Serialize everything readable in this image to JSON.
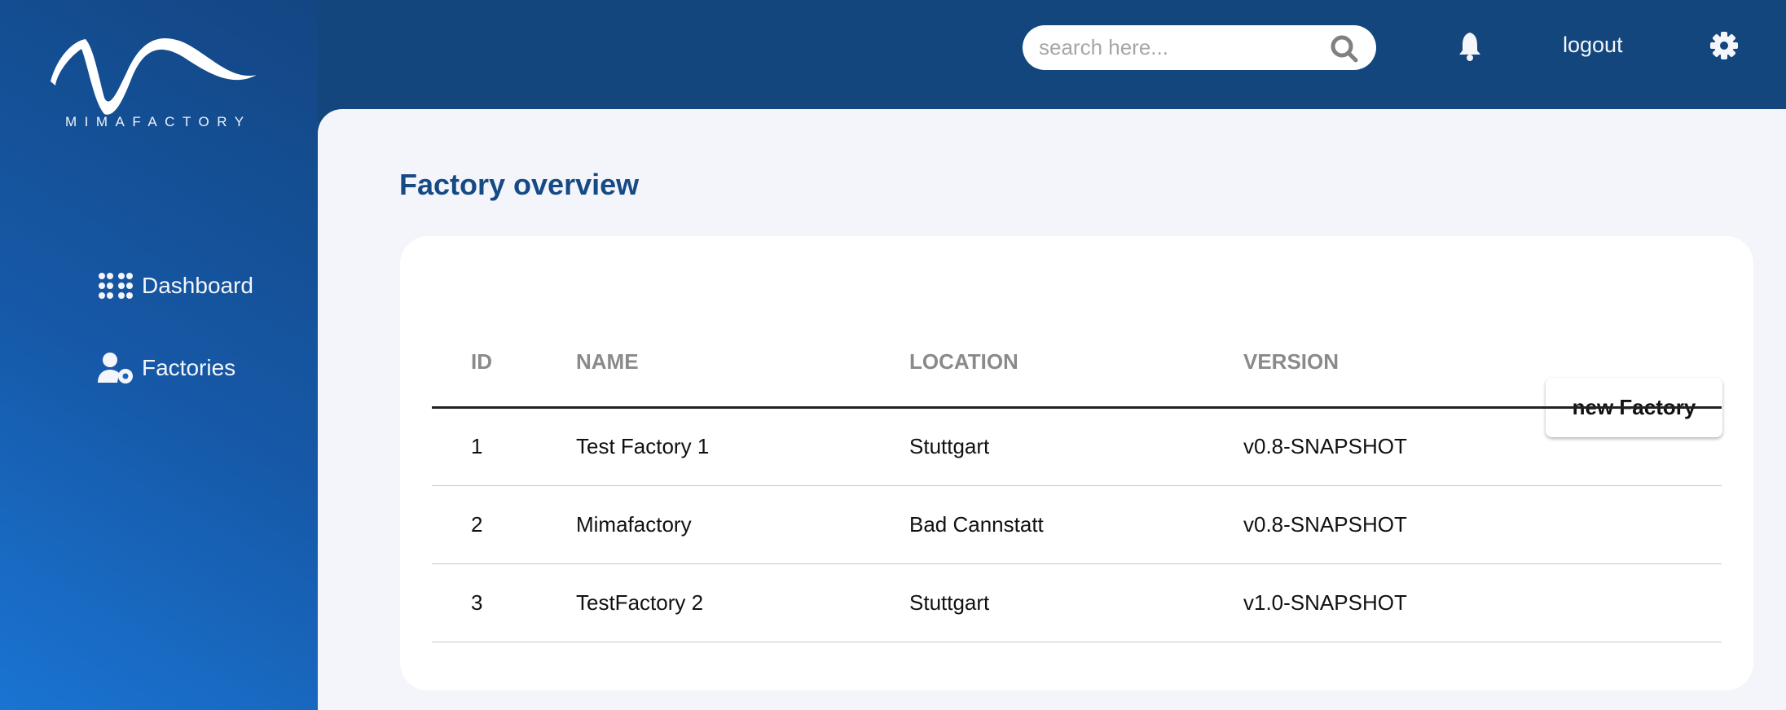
{
  "brand": {
    "name": "MIMAFACTORY"
  },
  "header": {
    "search_placeholder": "search here...",
    "logout_label": "logout"
  },
  "sidebar": {
    "items": [
      {
        "label": "Dashboard",
        "icon": "grid-dots-icon"
      },
      {
        "label": "Factories",
        "icon": "user-gear-icon"
      }
    ]
  },
  "main": {
    "title": "Factory overview",
    "new_button": "new Factory",
    "table": {
      "columns": [
        "ID",
        "NAME",
        "LOCATION",
        "VERSION"
      ],
      "rows": [
        [
          "1",
          "Test Factory 1",
          "Stuttgart",
          "v0.8-SNAPSHOT"
        ],
        [
          "2",
          "Mimafactory",
          "Bad Cannstatt",
          "v0.8-SNAPSHOT"
        ],
        [
          "3",
          "TestFactory 2",
          "Stuttgart",
          "v1.0-SNAPSHOT"
        ]
      ]
    }
  },
  "colors": {
    "header": "#13467c",
    "title": "#154a85",
    "background": "#f4f5fa"
  }
}
